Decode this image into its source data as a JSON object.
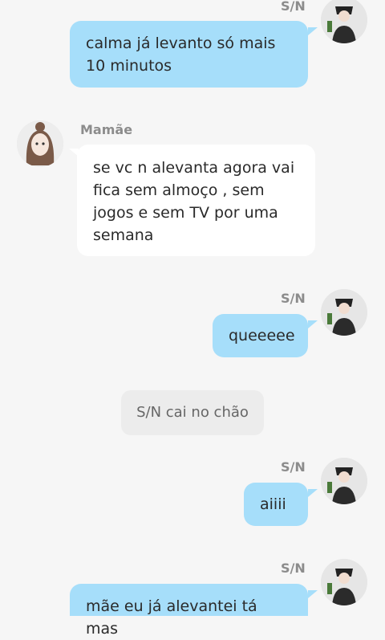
{
  "messages": [
    {
      "sender": "S/N",
      "text": "calma já levanto só mais 10 minutos"
    },
    {
      "sender": "Mamãe",
      "text": "se vc n alevanta agora vai fica sem almoço , sem jogos e sem TV por uma semana"
    },
    {
      "sender": "S/N",
      "text": "queeeee"
    },
    {
      "narration": "S/N cai no chão"
    },
    {
      "sender": "S/N",
      "text": "aiiii"
    },
    {
      "sender": "S/N",
      "text": "mãe eu já alevantei tá mas"
    }
  ],
  "colors": {
    "my_bubble": "#a6defa",
    "other_bubble": "#ffffff",
    "background": "#f6f6f6"
  }
}
